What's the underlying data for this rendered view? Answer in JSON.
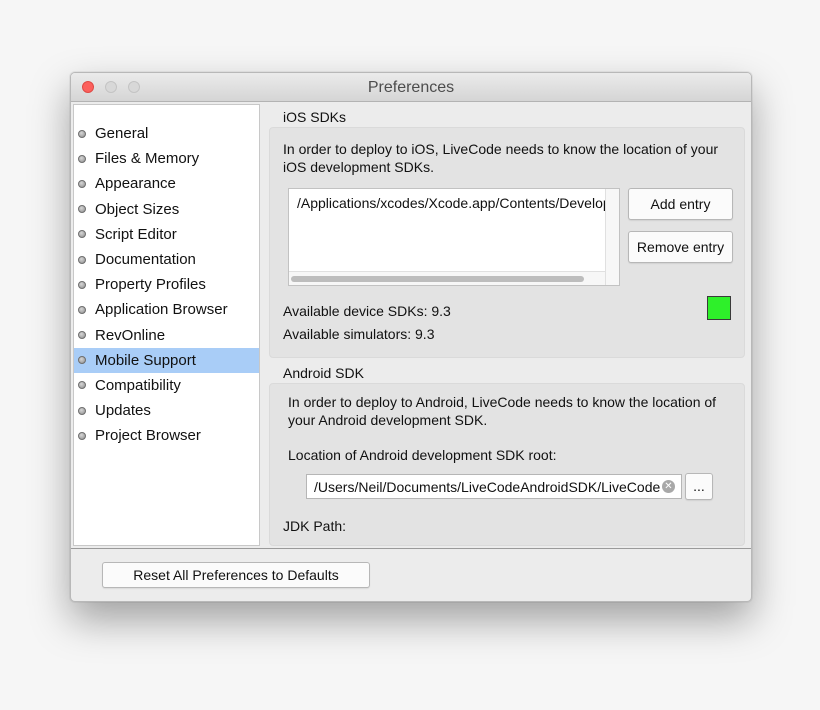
{
  "window": {
    "title": "Preferences"
  },
  "sidebar": {
    "items": [
      {
        "label": "General"
      },
      {
        "label": "Files & Memory"
      },
      {
        "label": "Appearance"
      },
      {
        "label": "Object Sizes"
      },
      {
        "label": "Script Editor"
      },
      {
        "label": "Documentation"
      },
      {
        "label": "Property Profiles"
      },
      {
        "label": "Application Browser"
      },
      {
        "label": "RevOnline"
      },
      {
        "label": "Mobile Support",
        "selected": true
      },
      {
        "label": "Compatibility"
      },
      {
        "label": "Updates"
      },
      {
        "label": "Project Browser"
      }
    ]
  },
  "ios": {
    "section_label": "iOS SDKs",
    "description": "In order to deploy to iOS, LiveCode needs to know the location of your iOS development SDKs.",
    "entries": [
      "/Applications/xcodes/Xcode.app/Contents/Developer"
    ],
    "add_button": "Add entry",
    "remove_button": "Remove entry",
    "device_sdks": "Available device SDKs: 9.3",
    "simulators": "Available simulators: 9.3",
    "status_color": "#2ef02a"
  },
  "android": {
    "section_label": "Android SDK",
    "description": "In order to deploy to Android, LiveCode needs to know the location of your Android development SDK.",
    "location_label": "Location of Android development SDK root:",
    "location_value": "/Users/Neil/Documents/LiveCodeAndroidSDK/LiveCode_",
    "browse_button": "...",
    "jdk_label": "JDK Path:"
  },
  "footer": {
    "reset_button": "Reset All Preferences to Defaults"
  }
}
